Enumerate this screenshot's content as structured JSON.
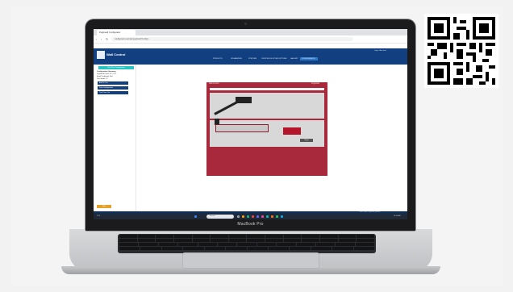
{
  "laptop_brand": "MacBook Pro",
  "browser": {
    "tab_title": "Pegboard Configurator",
    "url": "configurator.example/pegboard?config=..."
  },
  "site": {
    "name": "Wall Control",
    "account": "Login / Account",
    "menu": [
      "PRODUCTS",
      "ORGANIZERS",
      "SYSTEMS",
      "CUSTOM SOLUTIONS",
      "OPTIONS",
      "GALLERY",
      "CONFIGURATOR"
    ]
  },
  "sidebar": {
    "top_button": "Start New Configuration",
    "title": "Configuration Summary",
    "lines": [
      "Pegboard Panel: 32\" x 32\"",
      "Metal Pegboard: Red",
      "Total Items: 12"
    ],
    "buttons": [
      "Add To Cart",
      "Save Configuration",
      "Print Parts List"
    ],
    "bottom_button": "Help"
  },
  "board": {
    "left_label": "Wall Control",
    "right_label": "Pegboard",
    "badge": "Zoom"
  },
  "taskbar": {
    "search": "Search",
    "weather": "72°F",
    "clock": "10:42 AM"
  },
  "footer_text": "© Wall Control Pegboard Systems",
  "colors": {
    "site_header": "#113f7f",
    "accent_teal": "#27c4c4",
    "board_red": "#a8283c",
    "help_orange": "#e3a12b"
  }
}
